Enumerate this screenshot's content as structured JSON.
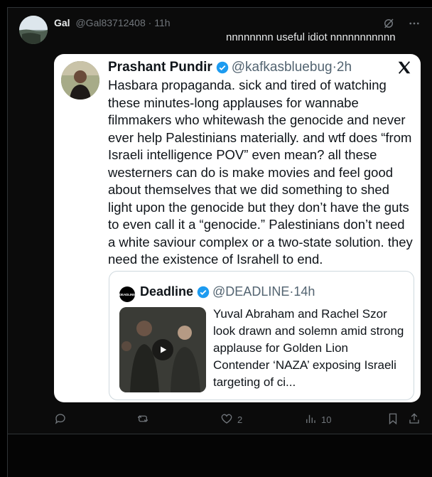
{
  "post": {
    "author_name": "Gal",
    "author_handle": "@Gal83712408",
    "separator": "·",
    "time": "11h",
    "text": "nnnnnnnn useful idiot nnnnnnnnnnn"
  },
  "quote": {
    "author_name": "Prashant Pundir",
    "author_handle": "@kafkasbluebug",
    "separator": "·",
    "time": "2h",
    "body": "Hasbara propaganda. sick and tired of watching these minutes-long applauses for wannabe filmmakers who whitewash the genocide and never ever help Palestinians materially. and wtf does “from Israeli intelligence POV” even mean? all these westerners can do is make movies and feel good about themselves that we did something to shed light upon the genocide but they don’t have the guts to even call it a “genocide.” Palestinians don’t need a white saviour complex or a two-state solution. they need the existence of Israhell to end.",
    "inner": {
      "logo_text": "DEADLINE",
      "author_name": "Deadline",
      "author_handle": "@DEADLINE",
      "separator": "·",
      "time": "14h",
      "text": "Yuval Abraham and Rachel Szor look drawn and solemn amid strong applause for Golden Lion Contender ‘NAZA’ exposing Israeli targeting of ci..."
    }
  },
  "actions": {
    "reply_count": "",
    "repost_count": "",
    "like_count": "2",
    "views_count": "10"
  },
  "icons": [
    "grok-icon",
    "more-icon",
    "verified-badge-icon",
    "x-logo-icon",
    "play-icon",
    "reply-icon",
    "repost-icon",
    "like-icon",
    "views-icon",
    "bookmark-icon",
    "share-icon"
  ],
  "colors": {
    "background": "#000000",
    "text": "#e7e9ea",
    "muted": "#71767b",
    "verified": "#1d9bf0",
    "card": "#ffffff"
  }
}
